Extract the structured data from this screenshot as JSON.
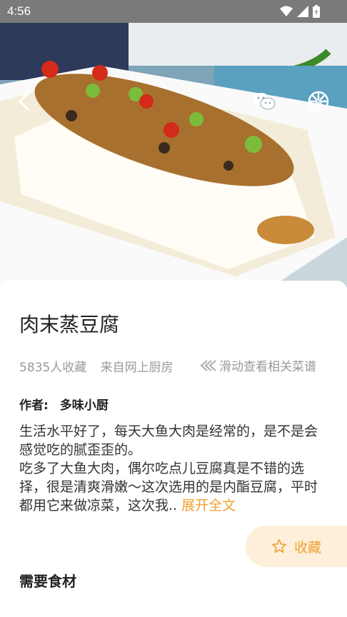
{
  "status_bar": {
    "time": "4:56"
  },
  "recipe": {
    "title": "肉末蒸豆腐",
    "favorites_count": "5835人收藏",
    "source": "来自网上厨房",
    "slide_hint": "滑动查看相关菜谱",
    "author_label": "作者:",
    "author_name": "多味小厨",
    "description_line1": "生活水平好了，每天大鱼大肉是经常的，是不是会感觉吃的腻歪歪的。",
    "description_line2": "吃多了大鱼大肉，偶尔吃点儿豆腐真是不错的选择，很是清爽滑嫩～这次选用的是内酯豆腐，平时都用它来做凉菜，这次我..",
    "expand_label": "展开全文"
  },
  "actions": {
    "favorite_label": "收藏"
  },
  "sections": {
    "ingredients_title": "需要食材"
  },
  "colors": {
    "accent": "#f0a030",
    "favorite_bg": "#fdefd9",
    "status_bar": "#7a7a7a"
  },
  "icons": [
    "back-arrow-icon",
    "wechat-icon",
    "moments-icon",
    "wifi-icon",
    "signal-icon",
    "battery-icon",
    "double-chevron-left-icon",
    "star-icon"
  ]
}
